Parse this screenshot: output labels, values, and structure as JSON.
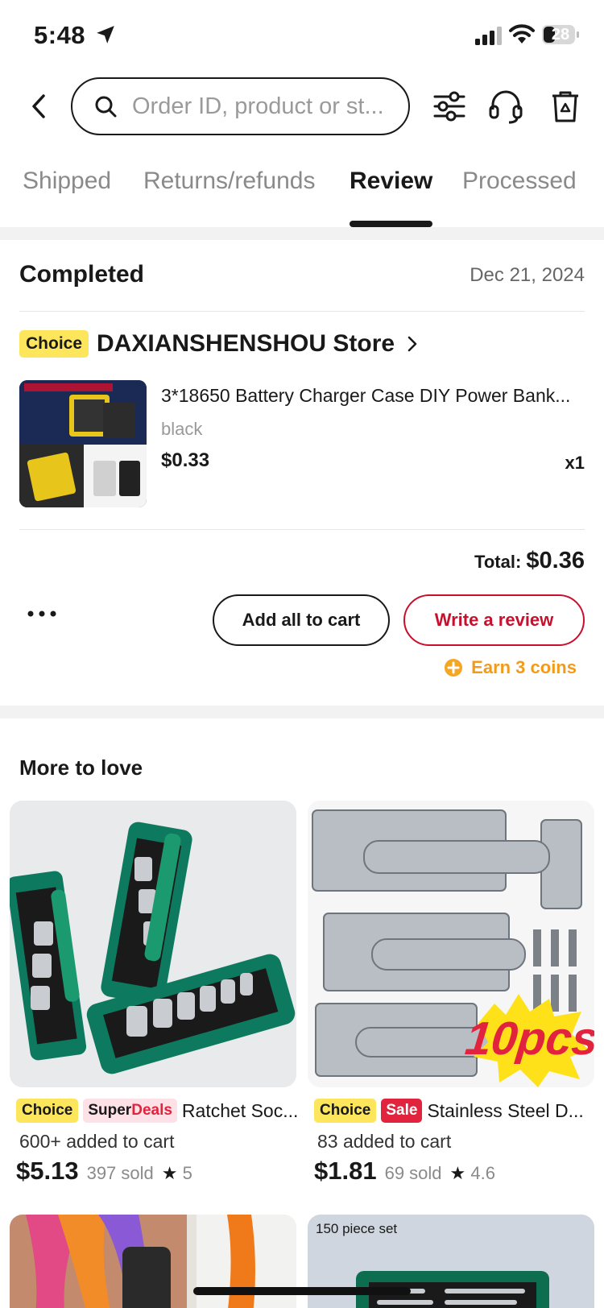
{
  "status_bar": {
    "time": "5:48",
    "battery": "28"
  },
  "search": {
    "placeholder": "Order ID, product or st..."
  },
  "tabs": [
    {
      "label": "Shipped",
      "active": false
    },
    {
      "label": "Returns/refunds",
      "active": false
    },
    {
      "label": "Review",
      "active": true
    },
    {
      "label": "Processed",
      "active": false
    }
  ],
  "order": {
    "status": "Completed",
    "date": "Dec 21, 2024",
    "choice_badge": "Choice",
    "store_name": "DAXIANSHENSHOU Store",
    "product": {
      "title": "3*18650 Battery Charger Case DIY Power Bank...",
      "variant": "black",
      "price": "$0.33",
      "qty": "x1"
    },
    "total_label": "Total:",
    "total_value": "$0.36",
    "add_to_cart_label": "Add all to cart",
    "write_review_label": "Write a review",
    "coins_label": "Earn 3 coins"
  },
  "more_to_love": {
    "title": "More to love",
    "items": [
      {
        "choice": "Choice",
        "tag_super": "Super",
        "tag_deals": "Deals",
        "name": "Ratchet Soc...",
        "added": "600+ added to cart",
        "price": "$5.13",
        "sold": "397 sold",
        "rating": "5"
      },
      {
        "choice": "Choice",
        "tag_sale": "Sale",
        "name": "Stainless Steel D...",
        "added": "83 added to cart",
        "price": "$1.81",
        "sold": "69 sold",
        "rating": "4.6",
        "image_text": "10pcs"
      }
    ],
    "next_row_overlay": "150 piece set"
  },
  "colors": {
    "accent_red": "#c8102e",
    "choice_yellow": "#fde55c",
    "coin_orange": "#f29b1b"
  }
}
